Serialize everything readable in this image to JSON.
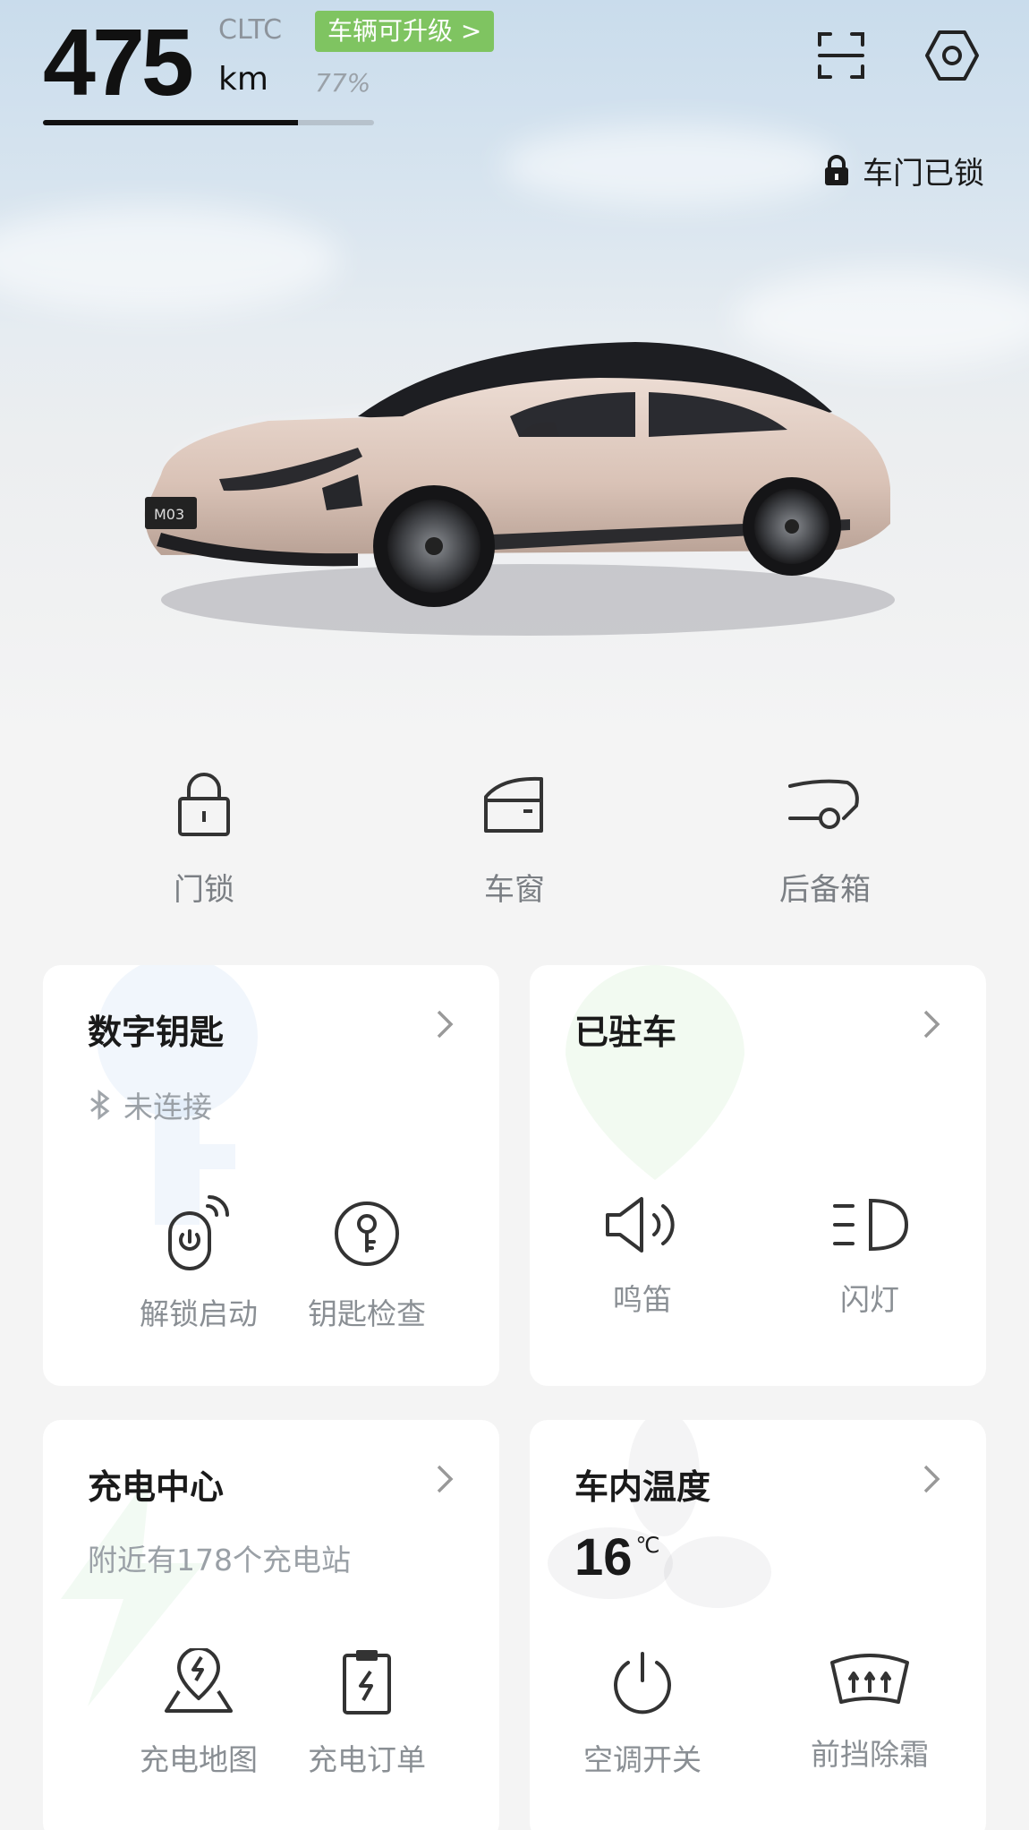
{
  "status": {
    "range_value": "475",
    "range_standard": "CLTC",
    "range_unit": "km",
    "upgrade_badge": "车辆可升级 >",
    "battery_percent": "77%",
    "battery_fraction": 0.77,
    "door_status": "车门已锁"
  },
  "quick_controls": [
    {
      "label": "门锁",
      "icon": "padlock-icon"
    },
    {
      "label": "车窗",
      "icon": "car-window-icon"
    },
    {
      "label": "后备箱",
      "icon": "trunk-icon"
    }
  ],
  "cards": {
    "digital_key": {
      "title": "数字钥匙",
      "status": "未连接",
      "actions": [
        {
          "label": "解锁启动",
          "icon": "key-fob-power-icon"
        },
        {
          "label": "钥匙检查",
          "icon": "key-check-icon"
        }
      ]
    },
    "parked": {
      "title": "已驻车",
      "actions": [
        {
          "label": "鸣笛",
          "icon": "horn-speaker-icon"
        },
        {
          "label": "闪灯",
          "icon": "headlight-icon"
        }
      ]
    },
    "charging": {
      "title": "充电中心",
      "subtitle": "附近有178个充电站",
      "actions": [
        {
          "label": "充电地图",
          "icon": "charging-map-icon"
        },
        {
          "label": "充电订单",
          "icon": "charging-order-icon"
        }
      ]
    },
    "climate": {
      "title": "车内温度",
      "temperature": "16",
      "temperature_unit": "℃",
      "actions": [
        {
          "label": "空调开关",
          "icon": "power-icon"
        },
        {
          "label": "前挡除霜",
          "icon": "front-defrost-icon"
        }
      ]
    }
  },
  "car_plate": "M03",
  "colors": {
    "upgrade_green": "#7fc461",
    "car_body": "#dcc6bb",
    "text_primary": "#1a1a1a",
    "text_secondary": "#8a8f94"
  }
}
